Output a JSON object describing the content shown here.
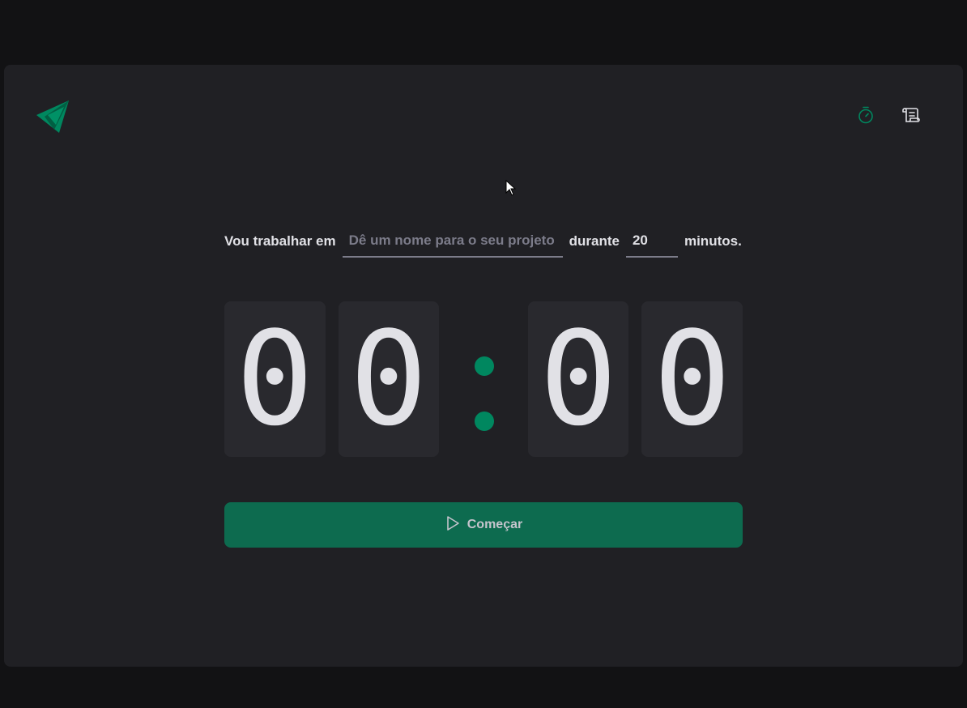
{
  "header": {
    "logo_icon": "timer-logo-icon",
    "nav": [
      {
        "icon": "timer-icon",
        "color": "#00875f"
      },
      {
        "icon": "history-scroll-icon",
        "color": "#e1e1e6"
      }
    ]
  },
  "form": {
    "label_task": "Vou trabalhar em",
    "task_placeholder": "Dê um nome para o seu projeto",
    "task_value": "",
    "label_duration": "durante",
    "minutes_value": "20",
    "label_minutes": "minutos."
  },
  "countdown": {
    "minutes_tens": "0",
    "minutes_ones": "0",
    "seconds_tens": "0",
    "seconds_ones": "0"
  },
  "start_button": {
    "label": "Começar",
    "icon": "play-icon"
  },
  "colors": {
    "background": "#121214",
    "panel": "#202024",
    "digit_box": "#29292e",
    "accent": "#00875f",
    "button": "#0d6b4f",
    "text": "#e1e1e6"
  }
}
